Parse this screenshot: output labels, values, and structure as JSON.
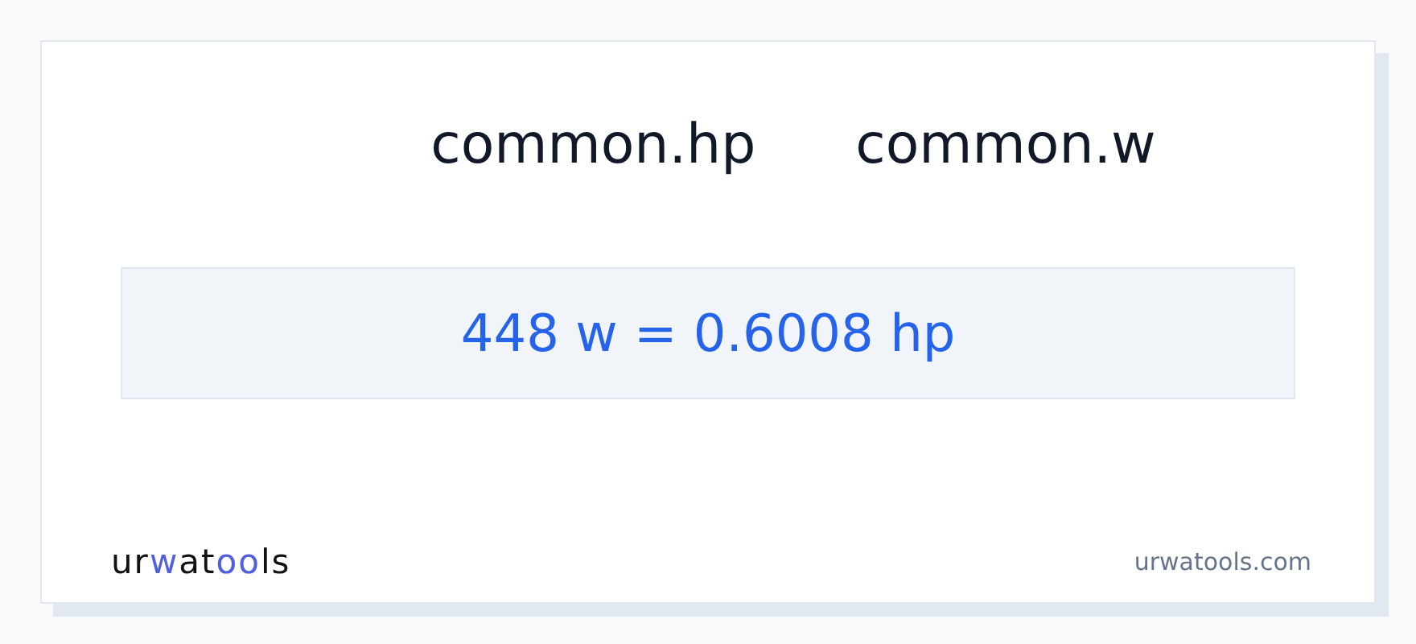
{
  "units": {
    "from": "common.hp",
    "to": "common.w"
  },
  "result": "448 w = 0.6008 hp",
  "footer": {
    "logo": [
      {
        "text": "ur",
        "accent": false
      },
      {
        "text": "w",
        "accent": true
      },
      {
        "text": "at",
        "accent": false
      },
      {
        "text": "oo",
        "accent": true
      },
      {
        "text": "ls",
        "accent": false
      }
    ],
    "site": "urwatools.com"
  }
}
